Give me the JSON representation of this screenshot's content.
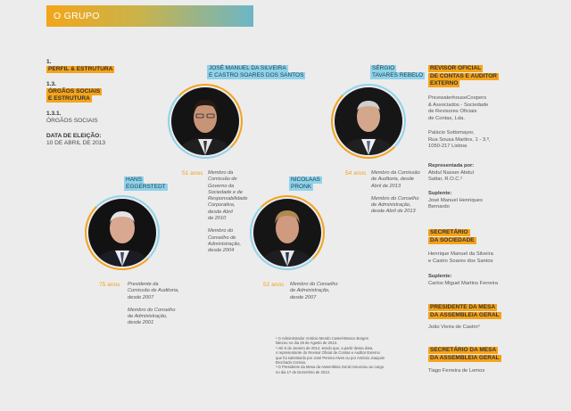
{
  "header": {
    "title": "O GRUPO"
  },
  "left": {
    "l1": "1.",
    "l1_label": "PERFIL & ESTRUTURA",
    "l2": "1.3.",
    "l2_label_a": "ÓRGÃOS SOCIAIS",
    "l2_label_b": "E ESTRUTURA",
    "l3": "1.3.1.",
    "l3_label": "ÓRGÃOS SOCIAIS",
    "date_label": "DATA DE ELEIÇÃO:",
    "date_value": "10 DE ABRIL DE 2013"
  },
  "people": [
    {
      "name_a": "JOSÉ MANUEL DA SILVEIRA",
      "name_b": "E CASTRO SOARES DOS SANTOS",
      "age": "51 anos",
      "desc1": [
        "Membro da",
        "Comissão de",
        "Governo da",
        "Sociedade e de",
        "Responsabilidade",
        "Corporativa,",
        "desde Abril",
        "de 2010"
      ],
      "desc2": [
        "Membro do",
        "Conselho de",
        "Administração,",
        "desde 2004"
      ]
    },
    {
      "name_a": "SÉRGIO",
      "name_b": "TAVARES REBELO",
      "age": "54 anos",
      "desc1": [
        "Membro da Comissão",
        "de Auditoria, desde",
        "Abril de 2013"
      ],
      "desc2": [
        "Membro do Conselho",
        "de Administração,",
        "desde Abril de 2013"
      ]
    },
    {
      "name_a": "HANS",
      "name_b": "EGGERSTEDT",
      "age": "75 anos",
      "desc1": [
        "Presidente da",
        "Comissão de Auditoria,",
        "desde 2007"
      ],
      "desc2": [
        "Membro do Conselho",
        "de Administração,",
        "desde 2001"
      ]
    },
    {
      "name_a": "NICOLAAS",
      "name_b": "PRONK",
      "age": "52 anos",
      "desc1": [
        "Membro do Conselho",
        "de Administração,",
        "desde 2007"
      ]
    }
  ],
  "right": {
    "auditor_h": [
      "REVISOR OFICIAL",
      "DE CONTAS E AUDITOR",
      "EXTERNO"
    ],
    "auditor_text": [
      "PricewaterhouseCoopers",
      "& Associados - Sociedade",
      "de Revisores Oficiais",
      "de Contas, Lda."
    ],
    "address": [
      "Palácio Sottomayor,",
      "Rua Sousa Martins, 1 - 3.º,",
      "1050-217 Lisboa"
    ],
    "rep_label": "Representada por:",
    "rep_text": [
      "Abdul Nasser Abdul",
      "Sattar, R.O.C.²"
    ],
    "sup1_label": "Suplente:",
    "sup1_text": [
      "José Manuel Henriques",
      "Bernardo"
    ],
    "sec_h": [
      "SECRETÁRIO",
      "DA SOCIEDADE"
    ],
    "sec_text": [
      "Henrique Manuel da Silveira",
      "e Castro Soares dos Santos"
    ],
    "sup2_label": "Suplente:",
    "sup2_text": "Carlos Miguel Martins Ferreira",
    "pres_h": [
      "PRESIDENTE DA MESA",
      "DA ASSEMBLEIA GERAL"
    ],
    "pres_text": "João Vieira de Castro³",
    "secm_h": [
      "SECRETÁRIO DA MESA",
      "DA ASSEMBLEIA GERAL"
    ],
    "secm_text": "Tiago Ferreira de Lemos"
  },
  "footnotes": [
    "¹ O Administrador António Mendo Castel-Branco Borges",
    "faleceu no dia 25 de Agosto de 2013.",
    "² Até 5 de Janeiro de 2014, sendo que, a partir dessa data,",
    "o representante do Revisor Oficial de Contas e Auditor Externo",
    "que foi substituído por José Pereira Alves ou por António Joaquim",
    "Brochado Correia.",
    "³ O Presidente da Mesa da Assembleia Geral renunciou ao cargo",
    "no dia 17 de Dezembro de 2013."
  ],
  "colors": {
    "orange": "#f5a31a",
    "blue": "#8fd3ea",
    "age": "#f3a21b"
  }
}
